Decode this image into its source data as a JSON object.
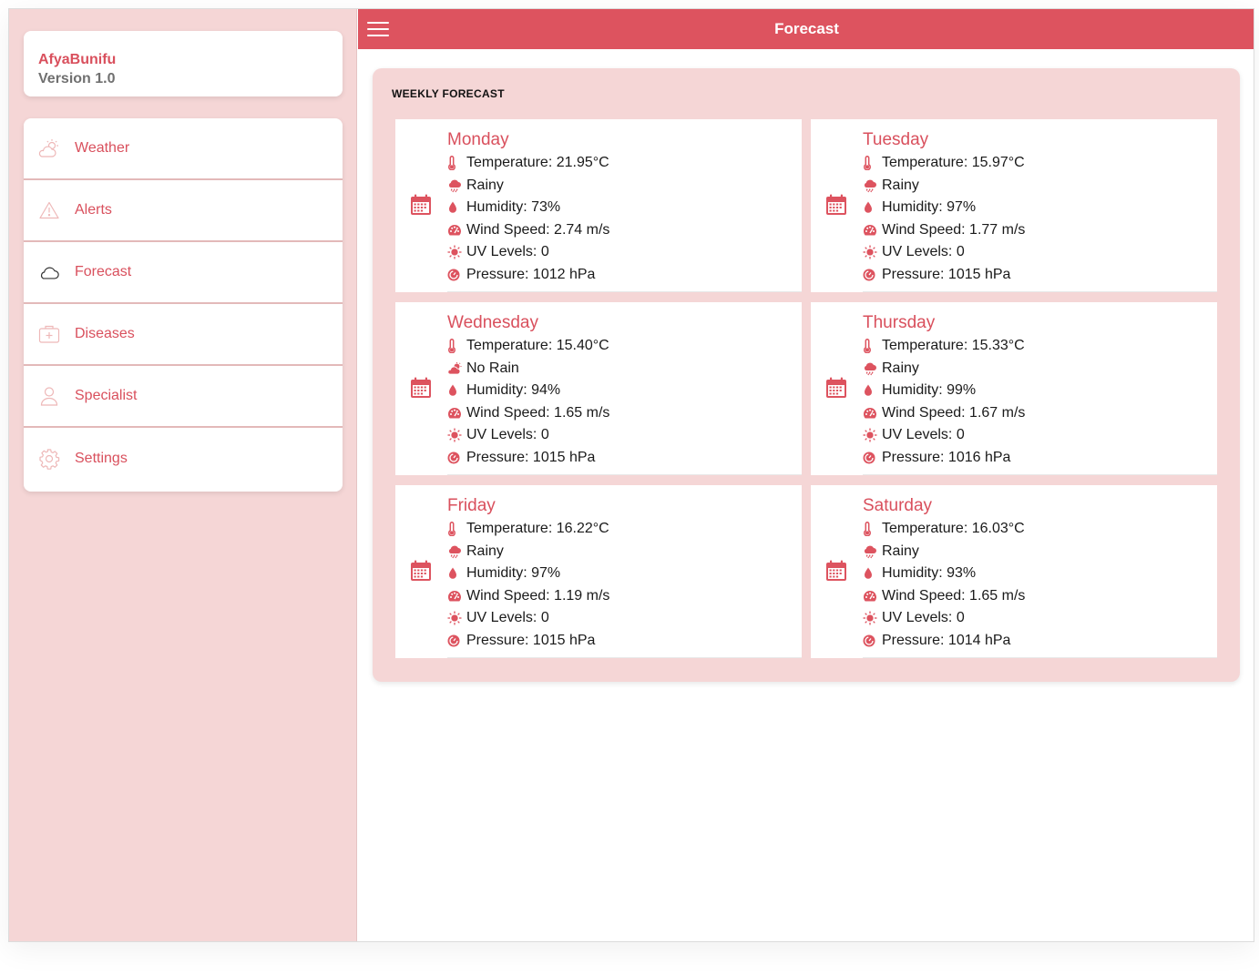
{
  "app": {
    "name": "AfyaBunifu",
    "version": "Version 1.0"
  },
  "sidebar": {
    "items": [
      {
        "label": "Weather",
        "icon": "partly-cloudy-icon"
      },
      {
        "label": "Alerts",
        "icon": "warning-icon"
      },
      {
        "label": "Forecast",
        "icon": "cloud-icon"
      },
      {
        "label": "Diseases",
        "icon": "medical-kit-icon"
      },
      {
        "label": "Specialist",
        "icon": "person-icon"
      },
      {
        "label": "Settings",
        "icon": "gear-icon"
      }
    ]
  },
  "header": {
    "title": "Forecast"
  },
  "panel": {
    "title": "WEEKLY FORECAST"
  },
  "days": [
    {
      "name": "Monday",
      "temperature": "Temperature: 21.95°C",
      "condition": "Rainy",
      "condition_icon": "rain-cloud-icon",
      "humidity": "Humidity: 73%",
      "wind": "Wind Speed: 2.74 m/s",
      "uv": "UV Levels: 0",
      "pressure": "Pressure: 1012 hPa"
    },
    {
      "name": "Tuesday",
      "temperature": "Temperature: 15.97°C",
      "condition": "Rainy",
      "condition_icon": "rain-cloud-icon",
      "humidity": "Humidity: 97%",
      "wind": "Wind Speed: 1.77 m/s",
      "uv": "UV Levels: 0",
      "pressure": "Pressure: 1015 hPa"
    },
    {
      "name": "Wednesday",
      "temperature": "Temperature: 15.40°C",
      "condition": "No Rain",
      "condition_icon": "partly-cloudy-icon",
      "humidity": "Humidity: 94%",
      "wind": "Wind Speed: 1.65 m/s",
      "uv": "UV Levels: 0",
      "pressure": "Pressure: 1015 hPa"
    },
    {
      "name": "Thursday",
      "temperature": "Temperature: 15.33°C",
      "condition": "Rainy",
      "condition_icon": "rain-cloud-icon",
      "humidity": "Humidity: 99%",
      "wind": "Wind Speed: 1.67 m/s",
      "uv": "UV Levels: 0",
      "pressure": "Pressure: 1016 hPa"
    },
    {
      "name": "Friday",
      "temperature": "Temperature: 16.22°C",
      "condition": "Rainy",
      "condition_icon": "rain-cloud-icon",
      "humidity": "Humidity: 97%",
      "wind": "Wind Speed: 1.19 m/s",
      "uv": "UV Levels: 0",
      "pressure": "Pressure: 1015 hPa"
    },
    {
      "name": "Saturday",
      "temperature": "Temperature: 16.03°C",
      "condition": "Rainy",
      "condition_icon": "rain-cloud-icon",
      "humidity": "Humidity: 93%",
      "wind": "Wind Speed: 1.65 m/s",
      "uv": "UV Levels: 0",
      "pressure": "Pressure: 1014 hPa"
    }
  ],
  "colors": {
    "accent": "#dd535f",
    "sidebar_bg": "#f5d6d6",
    "label": "#d9505d"
  }
}
